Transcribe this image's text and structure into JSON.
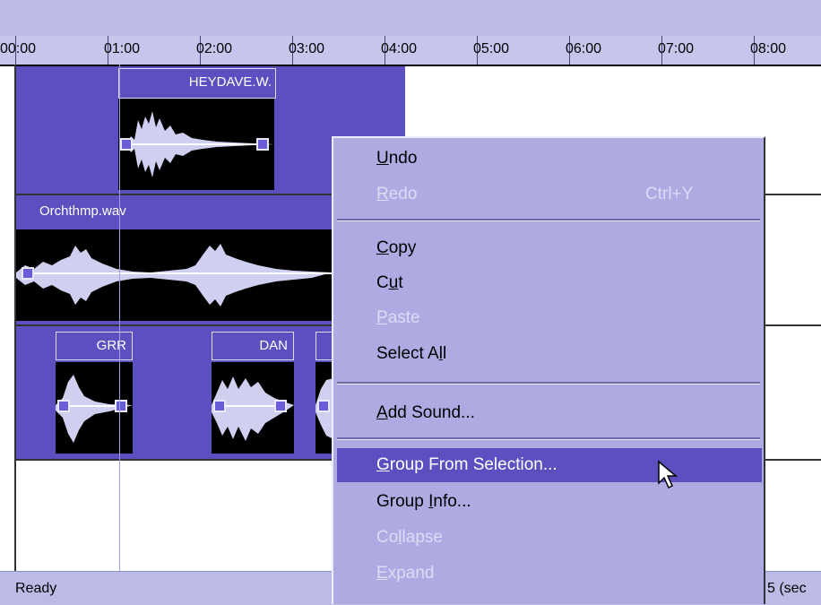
{
  "ruler": {
    "labels": [
      "00:00",
      "01:00",
      "02:00",
      "03:00",
      "04:00",
      "05:00",
      "06:00",
      "07:00",
      "08:00"
    ]
  },
  "tracks": {
    "track1": {
      "clip_label": "HEYDAVE.W."
    },
    "track2": {
      "clip_label": "Orchthmp.wav"
    },
    "track3": {
      "clips": [
        "GRR",
        "DAN"
      ]
    }
  },
  "context_menu": {
    "items": [
      {
        "label": "Undo",
        "accel": "U",
        "shortcut": "",
        "enabled": true
      },
      {
        "label": "Redo",
        "accel": "R",
        "shortcut": "Ctrl+Y",
        "enabled": false
      },
      {
        "label": "Copy",
        "accel": "C",
        "shortcut": "",
        "enabled": true
      },
      {
        "label": "Cut",
        "accel": "u",
        "shortcut": "",
        "enabled": true
      },
      {
        "label": "Paste",
        "accel": "P",
        "shortcut": "",
        "enabled": false
      },
      {
        "label": "Select All",
        "accel": "l",
        "shortcut": "",
        "enabled": true
      },
      {
        "label": "Add Sound...",
        "accel": "A",
        "shortcut": "",
        "enabled": true
      },
      {
        "label": "Group From Selection...",
        "accel": "G",
        "shortcut": "",
        "enabled": true,
        "highlighted": true
      },
      {
        "label": "Group Info...",
        "accel": "I",
        "shortcut": "",
        "enabled": true
      },
      {
        "label": "Collapse",
        "accel": "l",
        "shortcut": "",
        "enabled": false
      },
      {
        "label": "Expand",
        "accel": "E",
        "shortcut": "",
        "enabled": false
      }
    ]
  },
  "status": {
    "left": "Ready",
    "right": "5 (sec"
  },
  "colors": {
    "clip": "#5c4fc0",
    "menu_bg": "#aeaae2",
    "highlight": "#5c4fc0",
    "disabled_text": "#dddcf5"
  }
}
